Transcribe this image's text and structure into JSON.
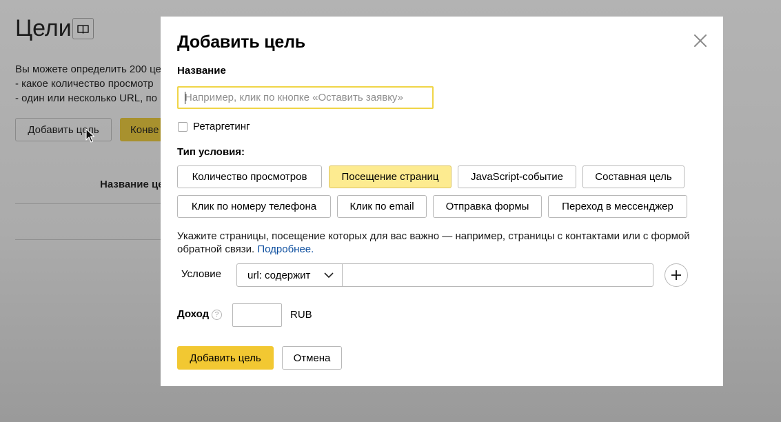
{
  "background": {
    "title": "Цели",
    "description": {
      "line1": "Вы можете определить 200 це",
      "line2": "-  какое количество просмотр",
      "line3": "-  один или несколько URL, по"
    },
    "add_goal_button": "Добавить цель",
    "conversion_button": "Конве",
    "column_header": "Название це"
  },
  "modal": {
    "title": "Добавить цель",
    "name_label": "Название",
    "name_placeholder": "Например, клик по кнопке «Оставить заявку»",
    "retargeting_label": "Ретаргетинг",
    "retargeting_checked": false,
    "condition_type_label": "Тип условия:",
    "condition_types": [
      {
        "label": "Количество просмотров",
        "active": false
      },
      {
        "label": "Посещение страниц",
        "active": true
      },
      {
        "label": "JavaScript-событие",
        "active": false
      },
      {
        "label": "Составная цель",
        "active": false
      },
      {
        "label": "Клик по номеру телефона",
        "active": false
      },
      {
        "label": "Клик по email",
        "active": false
      },
      {
        "label": "Отправка формы",
        "active": false
      },
      {
        "label": "Переход в мессенджер",
        "active": false
      }
    ],
    "hint_text": "Укажите страницы, посещение которых для вас важно — например, страницы с контактами или с формой обратной связи.",
    "hint_link": "Подробнее.",
    "condition_label": "Условие",
    "condition_select_value": "url: содержит",
    "condition_value": "",
    "income_label": "Доход",
    "income_help": "?",
    "income_value": "",
    "currency": "RUB",
    "submit_button": "Добавить цель",
    "cancel_button": "Отмена"
  },
  "colors": {
    "accent": "#f2c832",
    "active_tab": "#fdeb90",
    "focus_border": "#f0d547",
    "link": "#0b4d9e"
  }
}
